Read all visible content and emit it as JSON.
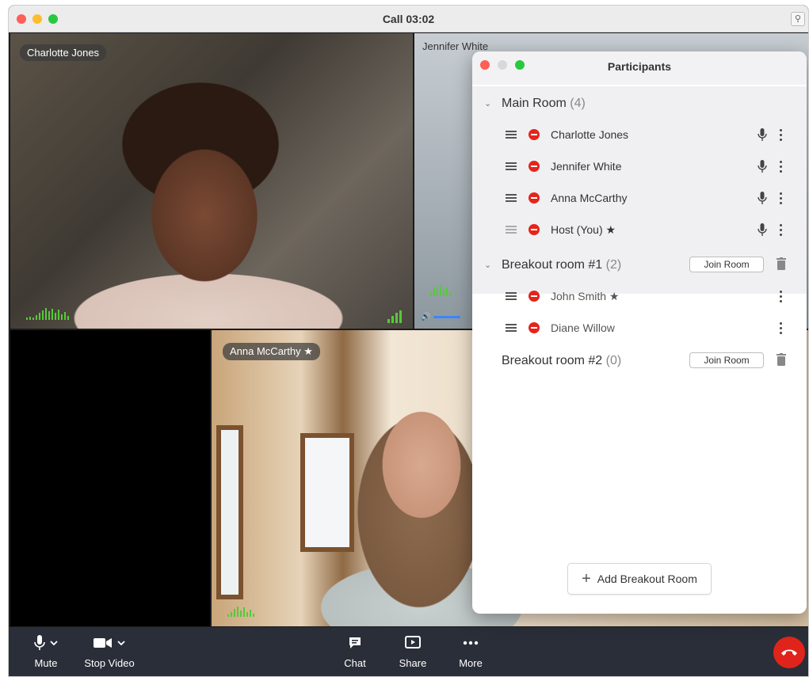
{
  "window": {
    "title": "Call 03:02"
  },
  "tiles": {
    "charlotte": {
      "name": "Charlotte Jones"
    },
    "jennifer": {
      "name": "Jennifer White"
    },
    "anna": {
      "name": "Anna McCarthy ★"
    }
  },
  "toolbar": {
    "mute_label": "Mute",
    "video_label": "Stop Video",
    "chat_label": "Chat",
    "share_label": "Share",
    "more_label": "More"
  },
  "participants_panel": {
    "title": "Participants",
    "main_room": {
      "name": "Main Room",
      "count": "(4)",
      "members": [
        {
          "name": "Charlotte Jones"
        },
        {
          "name": "Jennifer White"
        },
        {
          "name": "Anna McCarthy"
        },
        {
          "name": "Host (You) ★"
        }
      ]
    },
    "breakout_1": {
      "name": "Breakout room #1",
      "count": "(2)",
      "join_label": "Join Room",
      "members": [
        {
          "name": "John Smith ★"
        },
        {
          "name": "Diane Willow"
        }
      ]
    },
    "breakout_2": {
      "name": "Breakout room #2",
      "count": "(0)",
      "join_label": "Join Room"
    },
    "add_label": "Add Breakout Room"
  },
  "colors": {
    "traffic_red": "#fe5f57",
    "traffic_yellow": "#febc2e",
    "traffic_green": "#28c840",
    "end_call": "#e0241b",
    "remove_red": "#e5241c",
    "audio_green": "#56c93a",
    "toolbar_bg": "#2a2e38"
  },
  "icons": {
    "mute": "microphone-icon",
    "video": "video-camera-icon",
    "chat": "chat-bubble-icon",
    "share": "share-screen-icon",
    "more": "ellipsis-icon",
    "end_call": "phone-hangup-icon"
  }
}
